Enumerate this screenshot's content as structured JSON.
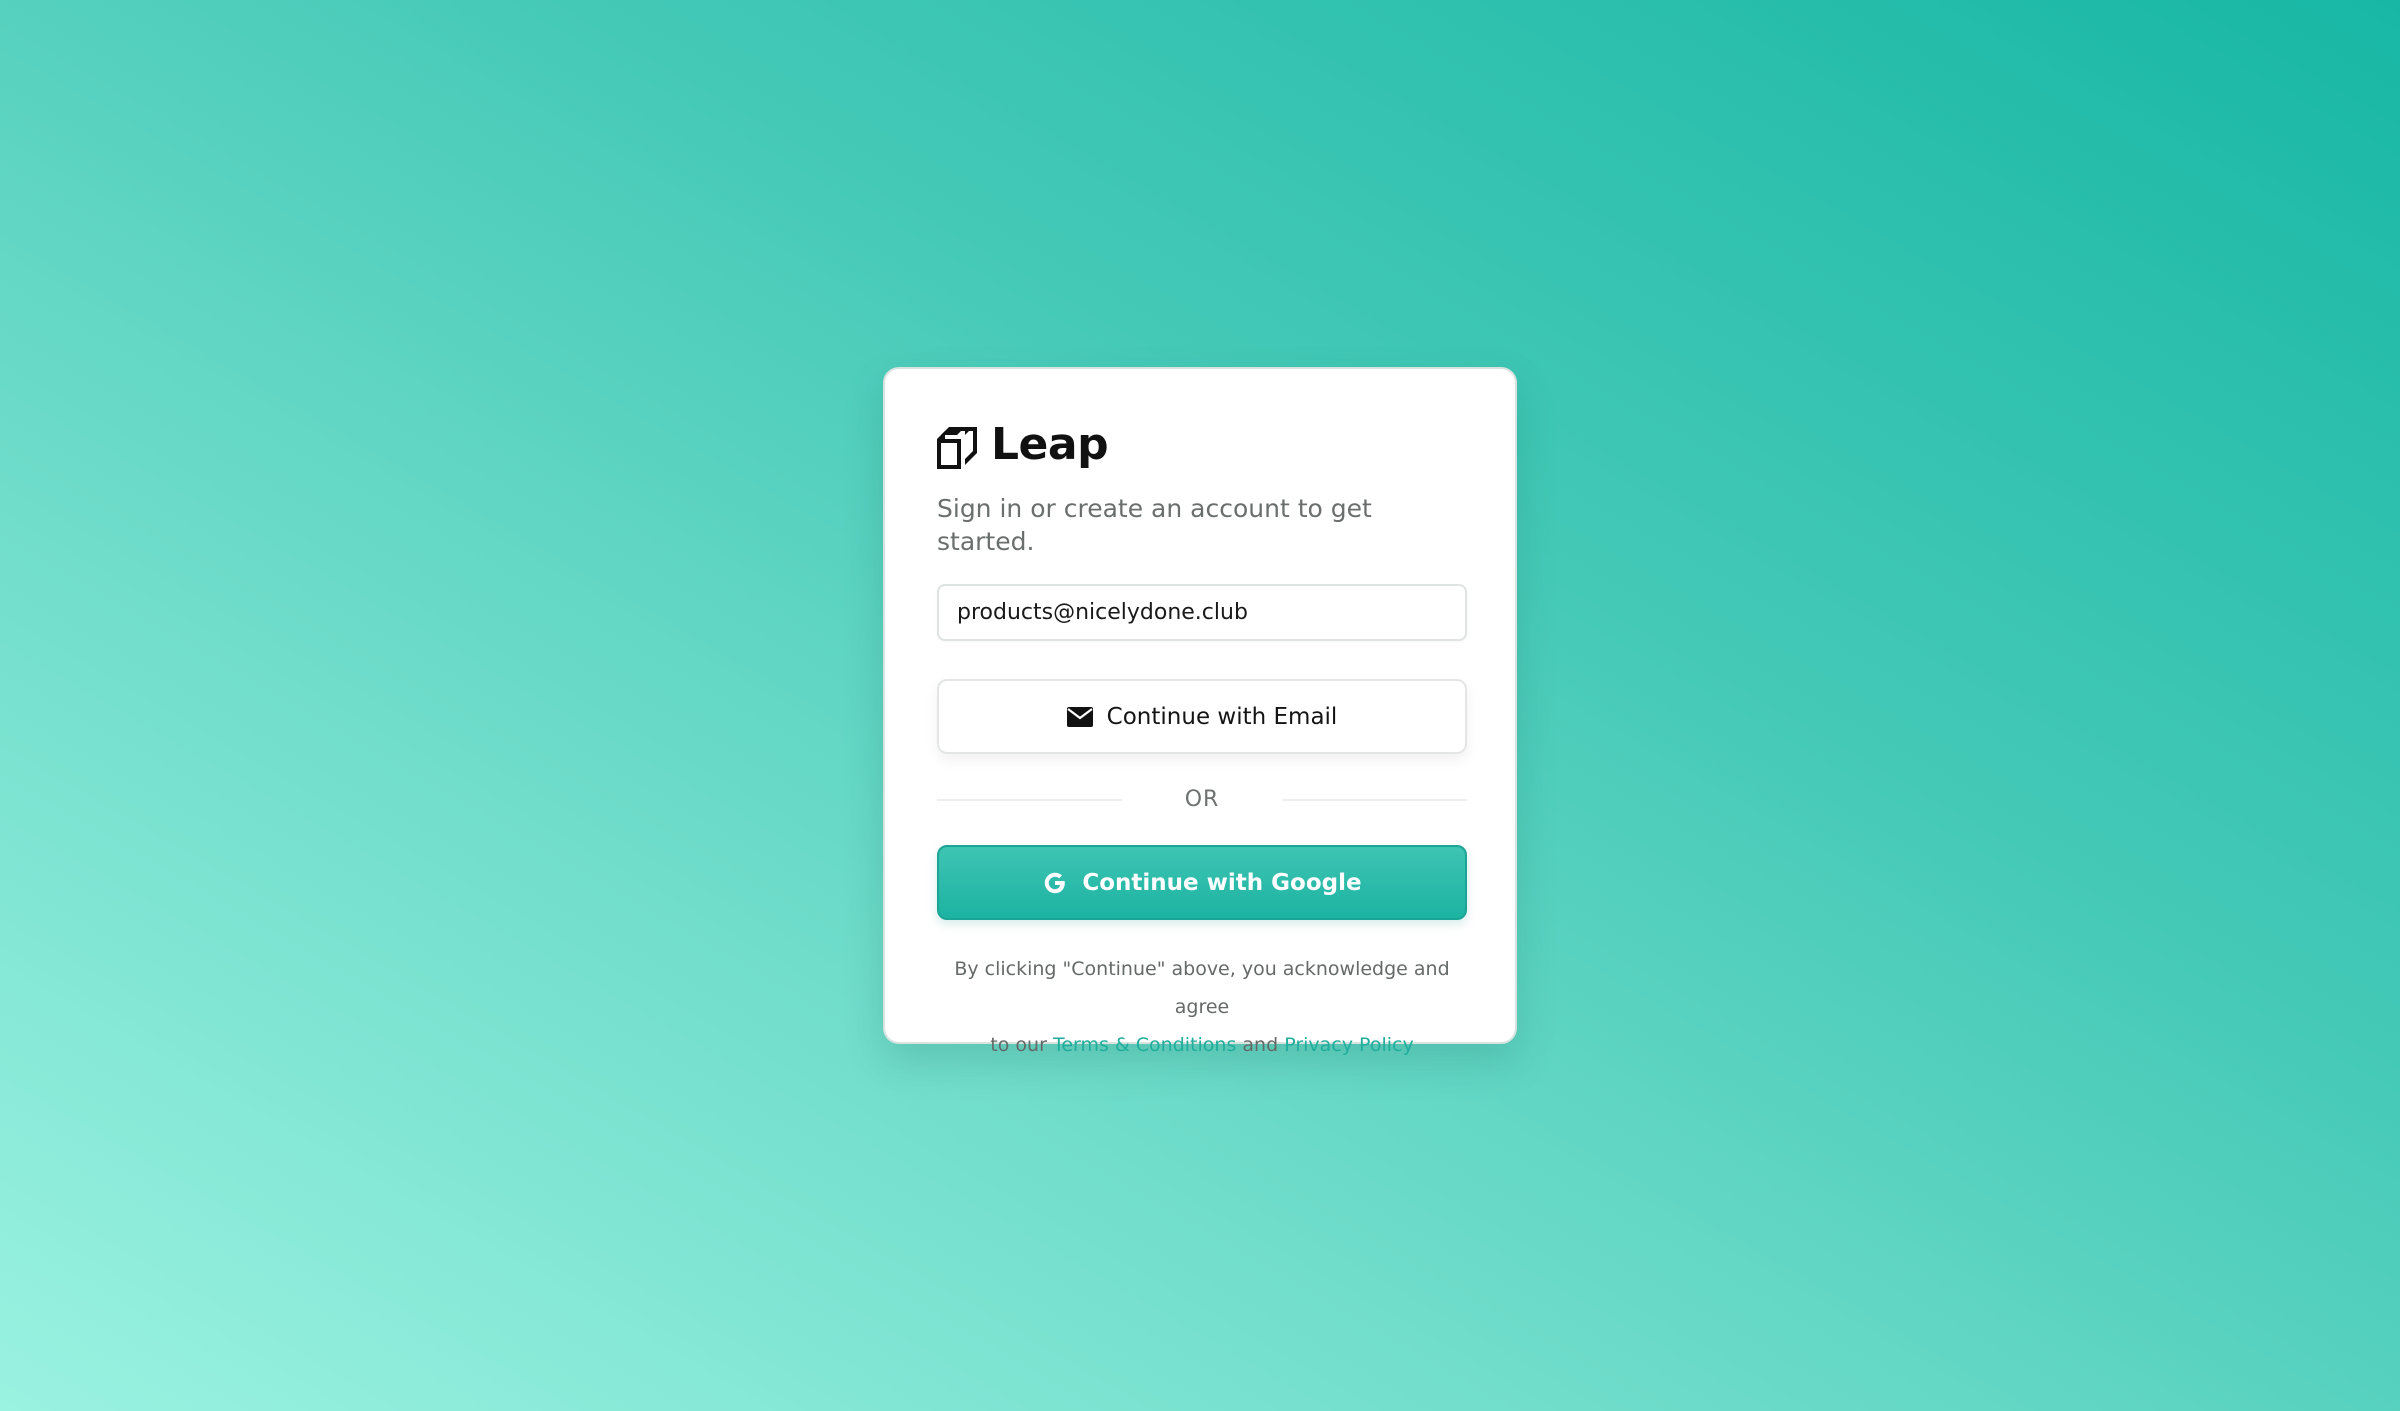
{
  "brand": {
    "name": "Leap",
    "logo_icon": "leap-logo-icon"
  },
  "subtitle": "Sign in or create an account to get started.",
  "email_input": {
    "value": "products@nicelydone.club",
    "placeholder": ""
  },
  "email_button": {
    "label": "Continue with Email",
    "icon": "mail-icon"
  },
  "divider": {
    "label": "OR"
  },
  "google_button": {
    "label": "Continue with Google",
    "icon": "google-icon"
  },
  "legal": {
    "line1": "By clicking \"Continue\" above, you acknowledge and agree",
    "prefix": "to our",
    "terms_link": "Terms & Conditions",
    "conjunction": "and",
    "privacy_link": "Privacy Policy"
  },
  "colors": {
    "accent": "#1fae9d",
    "background_start": "#9af2e1",
    "background_end": "#18b7a5",
    "card": "#ffffff"
  }
}
